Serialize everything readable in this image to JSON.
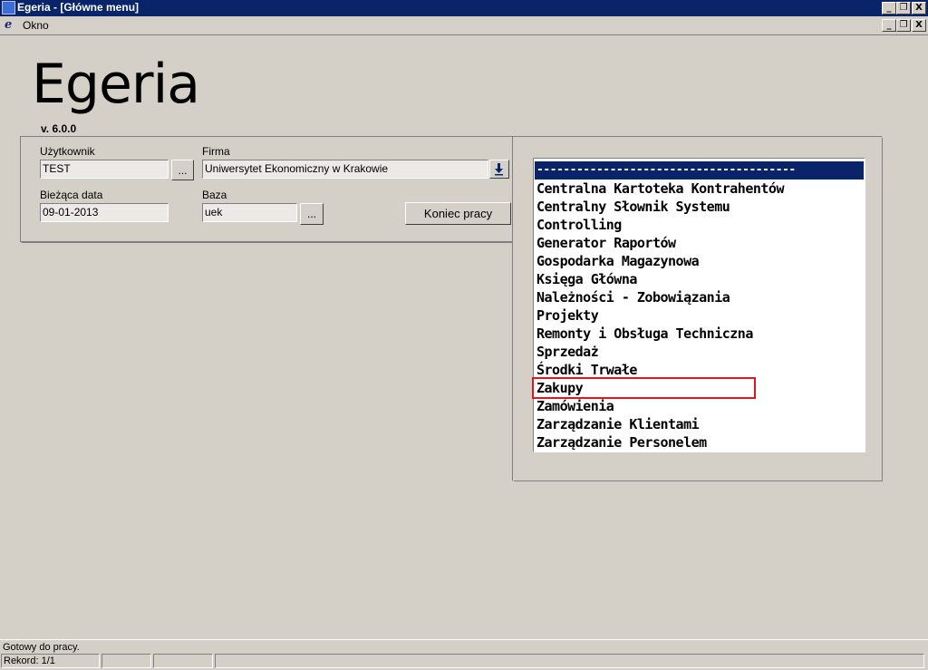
{
  "window": {
    "title": "Egeria - [Główne menu]",
    "controls": [
      "_",
      "❐",
      "X"
    ]
  },
  "menubar": {
    "icon": "egeria-e-icon",
    "okno": "Okno",
    "mdi_controls": [
      "_",
      "❐",
      "X"
    ]
  },
  "logo": {
    "text": "Egeria",
    "version": "v. 6.0.0"
  },
  "form": {
    "user_label": "Użytkownik",
    "user_value": "TEST",
    "user_browse": "...",
    "firm_label": "Firma",
    "firm_value": "Uniwersytet Ekonomiczny w Krakowie",
    "firm_dropdown_icon": "arrow-down-icon",
    "date_label": "Bieżąca data",
    "date_value": "09-01-2013",
    "db_label": "Baza",
    "db_value": "uek",
    "db_browse": "...",
    "end_button": "Koniec pracy"
  },
  "modules": {
    "selected": "---------------------------------------",
    "items": [
      "Centralna Kartoteka Kontrahentów",
      "Centralny Słownik Systemu",
      "Controlling",
      "Generator Raportów",
      "Gospodarka Magazynowa",
      "Księga Główna",
      "Należności - Zobowiązania",
      "Projekty",
      "Remonty i Obsługa Techniczna",
      "Sprzedaż",
      "Środki Trwałe",
      "Zakupy",
      "Zamówienia",
      "Zarządzanie Klientami",
      "Zarządzanie Personelem"
    ],
    "highlight_color": "#e0161c"
  },
  "status": {
    "message": "Gotowy do pracy.",
    "record": "Rekord: 1/1"
  },
  "colors": {
    "titlebar": "#0a246a",
    "background": "#d4d0c8",
    "selection": "#0a246a"
  }
}
